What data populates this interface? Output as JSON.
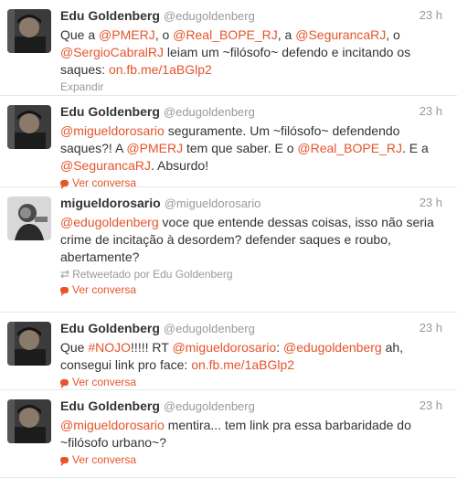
{
  "tweets": [
    {
      "name": "Edu Goldenberg",
      "handle": "@edugoldenberg",
      "time": "23 h",
      "segments": [
        {
          "t": "Que a "
        },
        {
          "t": "@PMERJ",
          "m": 1
        },
        {
          "t": ", o "
        },
        {
          "t": "@Real_BOPE_RJ",
          "m": 1
        },
        {
          "t": ", a "
        },
        {
          "t": "@SegurancaRJ",
          "m": 1
        },
        {
          "t": ", o "
        },
        {
          "t": "@SergioCabralRJ",
          "m": 1
        },
        {
          "t": " leiam um ~filósofo~ defendo e incitando os saques: "
        },
        {
          "t": "on.fb.me/1aBGlp2",
          "m": 1
        }
      ],
      "action": "Expandir"
    },
    {
      "name": "Edu Goldenberg",
      "handle": "@edugoldenberg",
      "time": "23 h",
      "segments": [
        {
          "t": "@migueldorosario",
          "m": 1
        },
        {
          "t": " seguramente. Um ~filósofo~ defendendo saques?! A "
        },
        {
          "t": "@PMERJ",
          "m": 1
        },
        {
          "t": " tem que saber. E o "
        },
        {
          "t": "@Real_BOPE_RJ",
          "m": 1
        },
        {
          "t": ". E a "
        },
        {
          "t": "@SegurancaRJ",
          "m": 1
        },
        {
          "t": ". Absurdo!"
        }
      ],
      "action": "Ver conversa"
    },
    {
      "name": "migueldorosario",
      "handle": "@migueldorosario",
      "time": "23 h",
      "segments": [
        {
          "t": "@edugoldenberg",
          "m": 1
        },
        {
          "t": " voce que entende dessas coisas, isso não seria crime de incitação à desordem? defender saques e roubo, abertamente?"
        }
      ],
      "retweeted_by": "Retweetado por Edu Goldenberg",
      "action": "Ver conversa"
    },
    {
      "name": "Edu Goldenberg",
      "handle": "@edugoldenberg",
      "time": "23 h",
      "segments": [
        {
          "t": "Que "
        },
        {
          "t": "#NOJO",
          "m": 1
        },
        {
          "t": "!!!!! RT "
        },
        {
          "t": "@migueldorosario",
          "m": 1
        },
        {
          "t": ": "
        },
        {
          "t": "@edugoldenberg",
          "m": 1
        },
        {
          "t": " ah, consegui link pro face: "
        },
        {
          "t": "on.fb.me/1aBGlp2",
          "m": 1
        }
      ],
      "action": "Ver conversa"
    },
    {
      "name": "Edu Goldenberg",
      "handle": "@edugoldenberg",
      "time": "23 h",
      "segments": [
        {
          "t": "@migueldorosario",
          "m": 1
        },
        {
          "t": " mentira... tem link pra essa barbaridade do ~filósofo urbano~?"
        }
      ],
      "action": "Ver conversa"
    }
  ],
  "colors": {
    "mention": "#e5542b",
    "meta": "#999999",
    "text": "#333333"
  },
  "icons": {
    "conversation": "speech-bubble-icon",
    "retweet": "retweet-icon"
  }
}
